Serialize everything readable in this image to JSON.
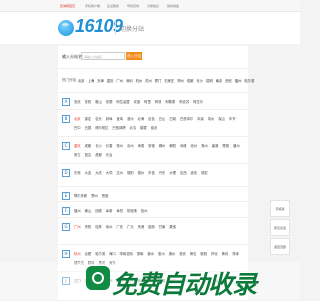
{
  "topbar": {
    "items": [
      "查询网首页",
      "手机客户端",
      "生活服务",
      "号码查询",
      "分类信息",
      "我的地盘"
    ]
  },
  "header": {
    "logo_text": "16109",
    "page_title": "切换分站"
  },
  "search": {
    "label": "输入分站名:",
    "placeholder": "请输入分站名",
    "button_label": "进入分站"
  },
  "hot": {
    "label": "热门分站:",
    "cities": [
      "北京",
      "上海",
      "天津",
      "重庆",
      "广州",
      "深圳",
      "杭州",
      "苏州",
      "厦门",
      "石家庄",
      "郑州",
      "成都",
      "长沙",
      "昆明",
      "南京",
      "西安",
      "福州",
      "哈尔滨"
    ]
  },
  "rows": [
    {
      "letter": "A",
      "cities": [
        "安庆",
        "安阳",
        "鞍山",
        "安顺",
        "阿拉善盟",
        "安康",
        "阿里",
        "阿坝",
        "阿勒泰",
        "阿克苏",
        "阿拉尔"
      ]
    },
    {
      "letter": "B",
      "cities": [
        "北京",
        "保定",
        "包头",
        "蚌埠",
        "宝鸡",
        "滨州",
        "北海",
        "百色",
        "白山",
        "白城",
        "巴彦淖尔",
        "本溪",
        "亳州",
        "保山",
        "毕节",
        "巴中",
        "白银",
        "博尔塔拉",
        "巴音郭楞",
        "北屯",
        "鹤壁",
        "临沧"
      ],
      "red": [
        0
      ]
    },
    {
      "letter": "C",
      "cities": [
        "重庆",
        "成都",
        "长沙",
        "长春",
        "常州",
        "沧州",
        "承德",
        "常德",
        "郴州",
        "朝阳",
        "赤峰",
        "池州",
        "滁州",
        "巢湖",
        "楚雄",
        "潮州",
        "崇左",
        "昌吉",
        "昌都",
        "长治"
      ],
      "red": [
        0
      ]
    },
    {
      "letter": "D",
      "cities": [
        "东莞",
        "大连",
        "大庆",
        "大同",
        "达州",
        "德阳",
        "德州",
        "东营",
        "丹东",
        "大理",
        "定西",
        "迪庆",
        "德宏"
      ]
    },
    {
      "letter": "E",
      "cities": [
        "鄂尔多斯",
        "鄂州",
        "恩施"
      ]
    },
    {
      "letter": "F",
      "cities": [
        "福州",
        "佛山",
        "抚顺",
        "阜新",
        "阜阳",
        "防城港",
        "抚州"
      ]
    },
    {
      "letter": "G",
      "cities": [
        "广州",
        "贵阳",
        "桂林",
        "赣州",
        "广安",
        "广元",
        "贵港",
        "固原",
        "甘南",
        "果洛"
      ],
      "red": [
        0
      ]
    },
    {
      "letter": "H",
      "cities": [
        "杭州",
        "合肥",
        "哈尔滨",
        "海口",
        "呼和浩特",
        "邯郸",
        "衡水",
        "惠州",
        "湖州",
        "淮安",
        "黄石",
        "衡阳",
        "怀化",
        "黄冈",
        "菏泽",
        "葫芦岛",
        "鹤岗",
        "黑河",
        "海东"
      ],
      "red": [
        0
      ]
    },
    {
      "letter": "J",
      "cities": [
        "江门",
        "济南",
        "吉林",
        "嘉兴",
        "金华",
        "九江",
        "荆州",
        "焦作",
        "晋城",
        "晋中",
        "锦州",
        "佳木斯",
        "揭阳",
        "景德镇"
      ]
    }
  ],
  "sidebar": {
    "buttons": [
      "手机版",
      "意见反馈",
      "返回顶部"
    ]
  },
  "banner": {
    "text": "免费自动收录"
  }
}
